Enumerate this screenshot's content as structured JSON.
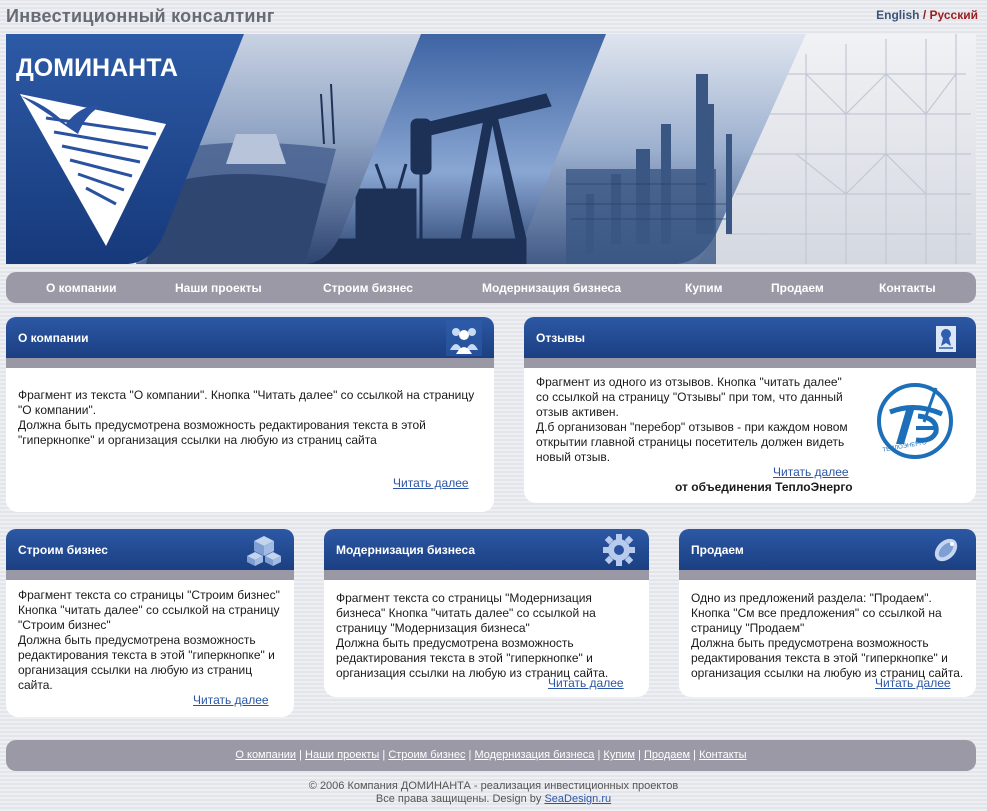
{
  "site": {
    "title": "Инвестиционный консалтинг",
    "lang_en": "English",
    "lang_sep": "/",
    "lang_ru": "Русский",
    "logo_text": "ДОМИНАНТА"
  },
  "nav": [
    {
      "label": "О компании"
    },
    {
      "label": "Наши проекты"
    },
    {
      "label": "Строим бизнес"
    },
    {
      "label": "Модернизация бизнеса"
    },
    {
      "label": "Купим"
    },
    {
      "label": "Продаем"
    },
    {
      "label": "Контакты"
    }
  ],
  "about": {
    "title": "О компании",
    "icon": "people-icon",
    "text": "Фрагмент из текста \"О компании\". Кнопка \"Читать далее\" со ссылкой на страницу \"О компании\".\nДолжна быть предусмотрена возможность редактирования текста в этой \"гиперкнопке\" и организация ссылки на любую из страниц сайта",
    "more": "Читать далее"
  },
  "reviews": {
    "title": "Отзывы",
    "icon": "certificate-icon",
    "text": "Фрагмент из одного из отзывов. Кнопка \"читать далее\" со ссылкой на страницу \"Отзывы\" при том, что данный отзыв активен.\nД.б организован \"перебор\" отзывов - при каждом новом открытии главной страницы посетитель должен видеть новый отзыв.",
    "more": "Читать далее",
    "author": "от объединения ТеплоЭнерго",
    "logo_text": "ТЕПЛОЭНЕРГО"
  },
  "build": {
    "title": "Строим бизнес",
    "icon": "cubes-icon",
    "text": "Фрагмент текста со страницы \"Строим бизнес\" Кнопка \"читать далее\" со ссылкой на страницу \"Строим бизнес\"\nДолжна быть предусмотрена возможность редактирования текста в этой \"гиперкнопке\" и организация ссылки на любую из страниц сайта.",
    "more": "Читать далее"
  },
  "modern": {
    "title": "Модернизация бизнеса",
    "icon": "gear-icon",
    "text": "Фрагмент текста со страницы \"Модернизация бизнеса\" Кнопка \"читать далее\" со ссылкой на страницу \"Модернизация бизнеса\"\nДолжна быть предусмотрена возможность редактирования текста в этой \"гиперкнопке\" и организация ссылки на любую из страниц сайта.",
    "more": "Читать далее"
  },
  "sell": {
    "title": "Продаем",
    "icon": "tag-icon",
    "text": "Одно из предложений раздела: \"Продаем\". Кнопка \"См все предложения\" со ссылкой на страницу \"Продаем\"\nДолжна быть предусмотрена возможность редактирования текста в этой \"гиперкнопке\" и организация ссылки на любую из страниц сайта.",
    "more": "Читать далее"
  },
  "footer": {
    "links": [
      {
        "label": "О компании"
      },
      {
        "label": "Наши проекты"
      },
      {
        "label": "Строим бизнес"
      },
      {
        "label": "Модернизация бизнеса"
      },
      {
        "label": "Купим"
      },
      {
        "label": "Продаем"
      },
      {
        "label": "Контакты"
      }
    ],
    "separator": "|",
    "copyright": "© 2006 Компания ДОМИНАНТА - реализация инвестиционных проектов",
    "rights": "Все права защищены. Design by",
    "designer": "SeaDesign.ru"
  },
  "colors": {
    "header_blue": "#1b3f82",
    "strip_gray": "#9a98a5",
    "link_blue": "#2b55a5",
    "lang_red": "#9a1e1e"
  }
}
